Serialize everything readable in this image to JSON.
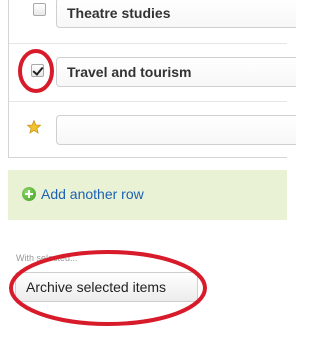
{
  "rows": [
    {
      "label": "Theatre studies",
      "checked": false
    },
    {
      "label": "Travel and tourism",
      "checked": true
    },
    {
      "label": "",
      "checked": false,
      "icon": "star-icon"
    }
  ],
  "add_row": {
    "label": "Add another row",
    "icon": "add-circle-icon"
  },
  "bulk_actions": {
    "with_selected_label": "With selected...",
    "archive_button_label": "Archive selected items"
  },
  "colors": {
    "link": "#1a61b3",
    "add_band": "#eaf2d6",
    "annotation": "#d81b2a",
    "star": "#f2c12e"
  }
}
